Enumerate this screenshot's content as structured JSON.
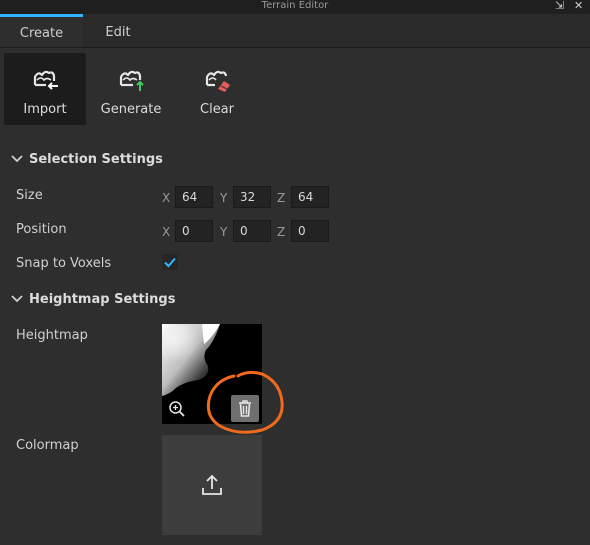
{
  "window": {
    "title": "Terrain Editor",
    "controls": {
      "restore": "⇲",
      "close": "✕"
    }
  },
  "tabs": [
    {
      "label": "Create",
      "active": true
    },
    {
      "label": "Edit",
      "active": false
    }
  ],
  "toolbar": {
    "buttons": [
      {
        "label": "Import",
        "icon": "terrain-import-icon",
        "active": true
      },
      {
        "label": "Generate",
        "icon": "terrain-generate-icon",
        "active": false
      },
      {
        "label": "Clear",
        "icon": "terrain-clear-icon",
        "active": false
      }
    ]
  },
  "selection_settings": {
    "title": "Selection Settings",
    "size": {
      "label": "Size",
      "x": "64",
      "y": "32",
      "z": "64"
    },
    "position": {
      "label": "Position",
      "x": "0",
      "y": "0",
      "z": "0"
    },
    "snap": {
      "label": "Snap to Voxels",
      "checked": true
    },
    "axes": {
      "x": "X",
      "y": "Y",
      "z": "Z"
    }
  },
  "heightmap_settings": {
    "title": "Heightmap Settings",
    "heightmap_label": "Heightmap",
    "colormap_label": "Colormap"
  },
  "colors": {
    "accent": "#35b5ff",
    "background": "#2e2e2e",
    "annotation": "#f06a1e",
    "generate_arrow": "#3ecf5a",
    "clear_brush": "#e85c5c"
  }
}
